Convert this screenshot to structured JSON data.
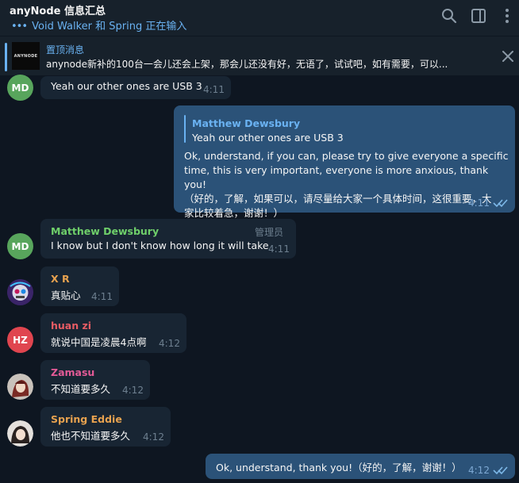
{
  "header": {
    "title": "anyNode 信息汇总",
    "typing_dots": "•••",
    "typing": "Void Walker 和 Spring 正在输入"
  },
  "pinned": {
    "label": "置顶消息",
    "thumb_text": "ANYNODE",
    "text": "anynode新补的100台一会儿还会上架，那会儿还没有好，无语了，试试吧，如有需要，可以..."
  },
  "messages": [
    {
      "avatar": "MD",
      "avatar_color": "#58a55c",
      "text": "Yeah our other ones are USB 3",
      "time": "4:11"
    },
    {
      "reply_name": "Matthew Dewsbury",
      "reply_text": "Yeah our other ones are USB 3",
      "lines": [
        "Ok, understand, if you can, please try to give everyone a specific",
        "time, this is very important, everyone is more anxious, thank you!",
        "（好的，了解，如果可以，请尽量给大家一个具体时间，这很重要，大",
        "家比较着急，谢谢！）"
      ],
      "time": "4:11"
    },
    {
      "avatar": "MD",
      "avatar_color": "#58a55c",
      "sender": "Matthew Dewsbury",
      "sender_color": "#6fcf6a",
      "role": "管理员",
      "text": "I know but I don't know how long it will take",
      "time": "4:11"
    },
    {
      "sender": "X R",
      "sender_color": "#e8a24f",
      "text": "真贴心",
      "time": "4:11"
    },
    {
      "avatar": "HZ",
      "avatar_color": "#e0454f",
      "sender": "huan zi",
      "sender_color": "#e85c64",
      "text": "就说中国是凌晨4点啊",
      "time": "4:12"
    },
    {
      "sender": "Zamasu",
      "sender_color": "#e45b97",
      "text": "不知道要多久",
      "time": "4:12"
    },
    {
      "sender": "Spring Eddie",
      "sender_color": "#e8a24f",
      "text": "他也不知道要多久",
      "time": "4:12"
    },
    {
      "text": "Ok, understand, thank you!（好的，了解，谢谢！）",
      "time": "4:12"
    }
  ]
}
